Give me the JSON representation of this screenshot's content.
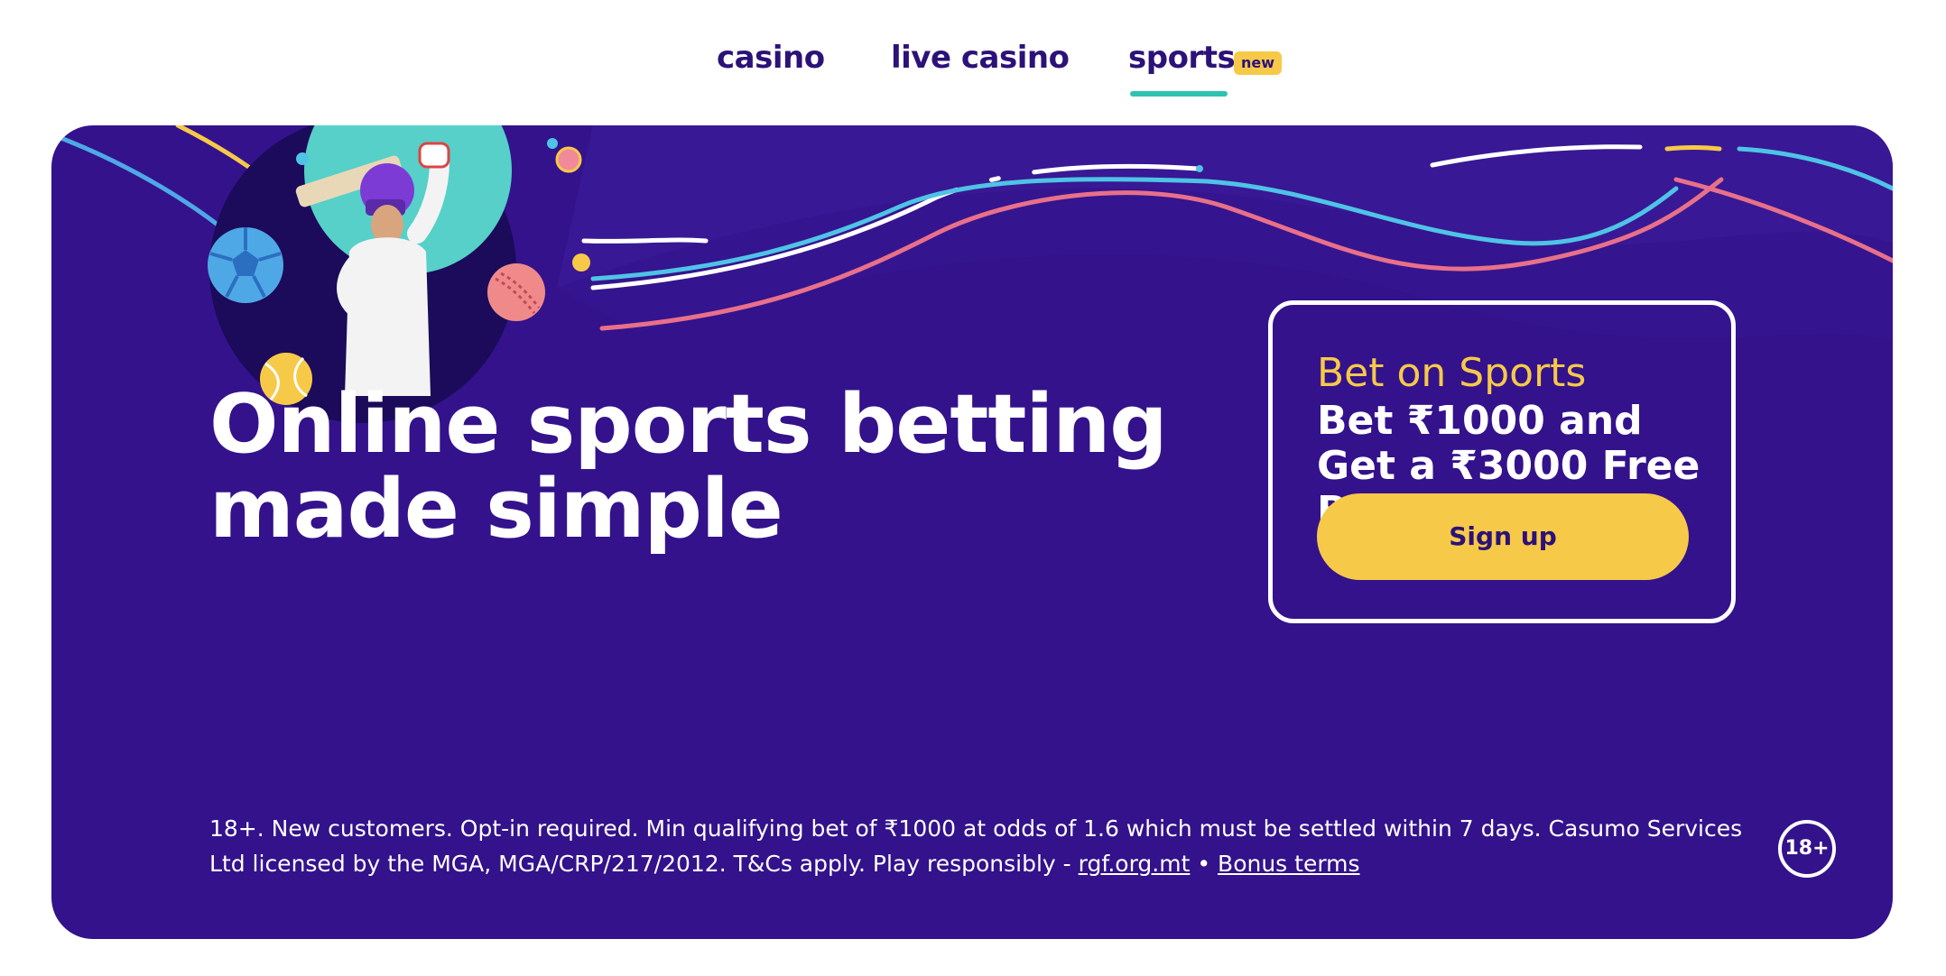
{
  "nav": {
    "items": [
      {
        "label": "casino"
      },
      {
        "label": "live casino"
      },
      {
        "label": "sports",
        "active": true,
        "badge": "new"
      }
    ],
    "accent_color": "#2ec2b2",
    "text_color": "#2c1278"
  },
  "hero": {
    "background_color": "#33128c",
    "headline_line1": "Online sports betting",
    "headline_line2": "made simple",
    "illustration_icons": [
      "cricket-player-icon",
      "football-icon",
      "cricket-ball-icon",
      "tennis-ball-icon"
    ]
  },
  "promo": {
    "kicker": "Bet on Sports",
    "offer": "Bet ₹1000 and Get a ₹3000 Free Bet*",
    "signup_label": "Sign up",
    "button_color": "#f7c948"
  },
  "terms": {
    "text": "18+. New customers. Opt-in required. Min qualifying bet of ₹1000 at odds of 1.6  which must be settled within 7 days. Casumo Services Ltd licensed by the MGA, MGA/CRP/217/2012. T&Cs apply. Play responsibly - ",
    "link_rgf": "rgf.org.mt",
    "separator": " • ",
    "link_bonus": "Bonus terms",
    "age_badge": "18+"
  }
}
